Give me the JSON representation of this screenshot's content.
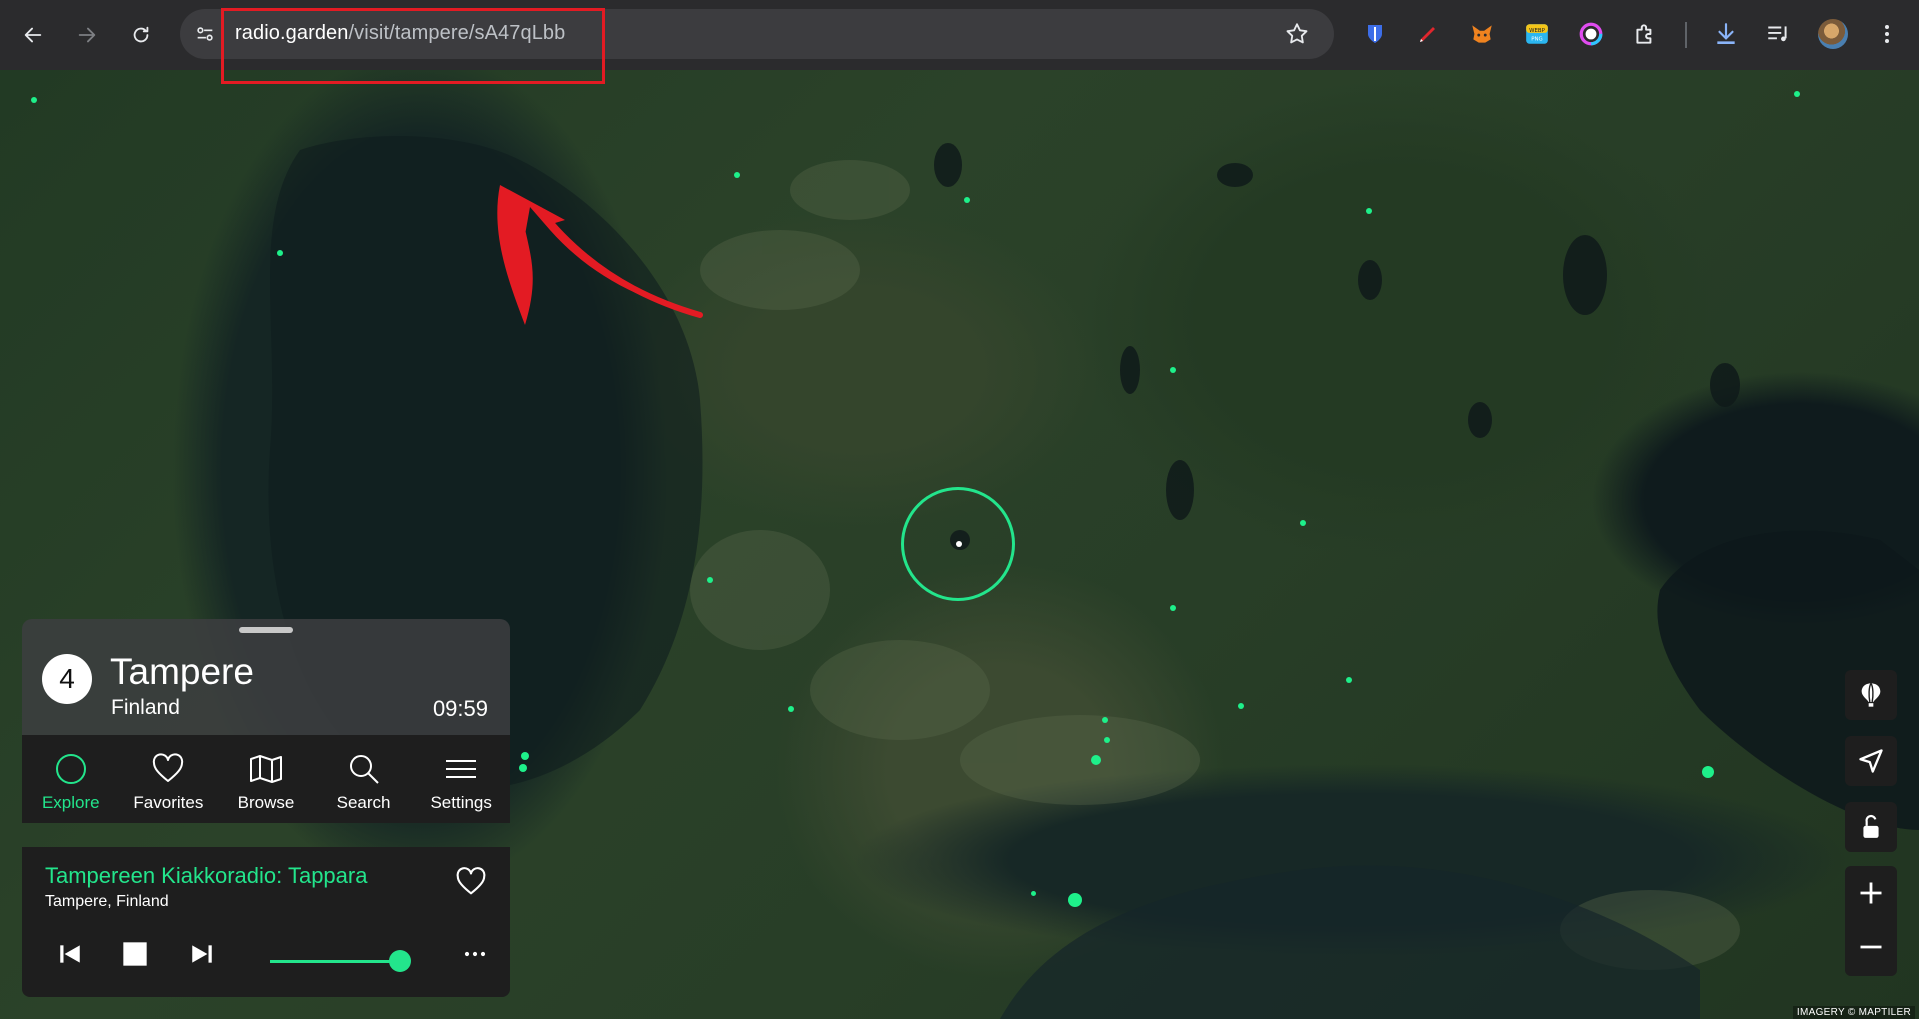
{
  "browser": {
    "url_host": "radio.garden",
    "url_path": "/visit/tampere/sA47qLbb",
    "icons": [
      "back-icon",
      "forward-icon",
      "reload-icon",
      "site-info-icon",
      "bookmark-star-icon",
      "bitwarden-icon",
      "pen-icon",
      "metamask-icon",
      "webp-png-icon",
      "color-ring-icon",
      "extensions-icon",
      "download-icon",
      "media-icon",
      "menu-icon"
    ]
  },
  "annotation": {
    "color": "#e31b23"
  },
  "map": {
    "attribution": "IMAGERY © MAPTILER",
    "accent": "#23e58c"
  },
  "place": {
    "count": "4",
    "title": "Tampere",
    "country": "Finland",
    "time": "09:59"
  },
  "tabs": [
    {
      "label": "Explore",
      "active": true
    },
    {
      "label": "Favorites",
      "active": false
    },
    {
      "label": "Browse",
      "active": false
    },
    {
      "label": "Search",
      "active": false
    },
    {
      "label": "Settings",
      "active": false
    }
  ],
  "player": {
    "station": "Tampereen Kiakkoradio: Tappara",
    "location": "Tampere, Finland",
    "volume": 1.0
  }
}
